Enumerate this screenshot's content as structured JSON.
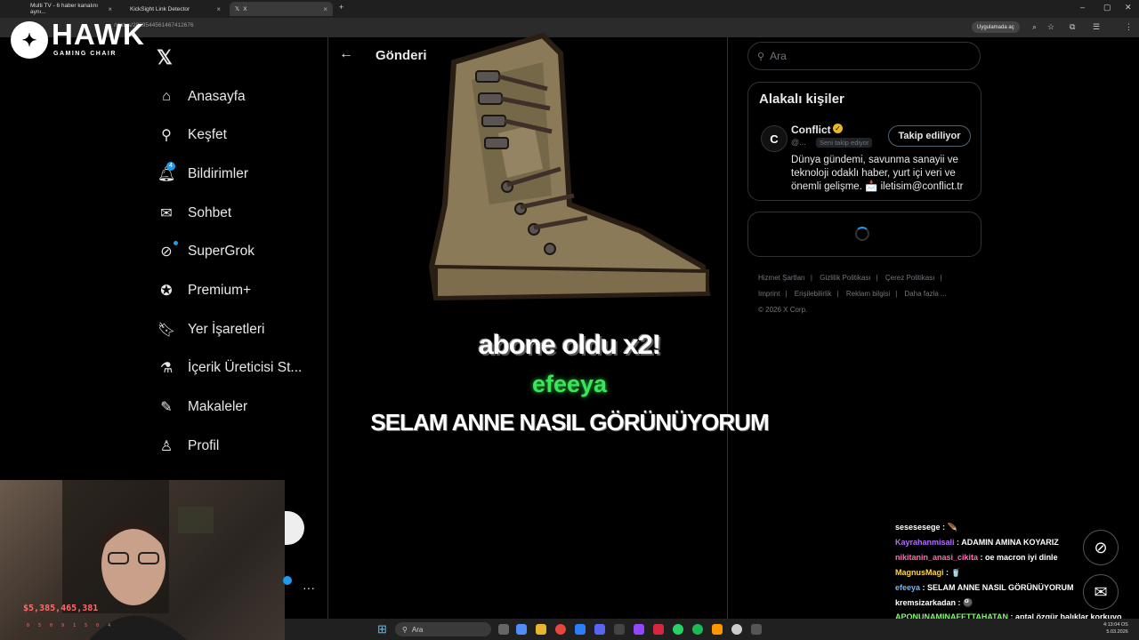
{
  "browser": {
    "tabs": [
      {
        "title": "Multi TV - 6 haber kanalını aynı..."
      },
      {
        "title": "KickSight Link Detector"
      },
      {
        "title": "X"
      }
    ],
    "url": "/status/2029544561467412676",
    "open_in_app": "Uygulamada aç"
  },
  "overlay": {
    "brand": "HAWK",
    "brand_sub": "GAMING CHAIR"
  },
  "nav": {
    "items": [
      {
        "label": "Anasayfa",
        "icon": "home-icon"
      },
      {
        "label": "Keşfet",
        "icon": "search-icon"
      },
      {
        "label": "Bildirimler",
        "icon": "bell-icon",
        "badge": "4"
      },
      {
        "label": "Sohbet",
        "icon": "mail-icon"
      },
      {
        "label": "SuperGrok",
        "icon": "grok-icon"
      },
      {
        "label": "Premium+",
        "icon": "verified-icon"
      },
      {
        "label": "Yer İşaretleri",
        "icon": "bookmark-icon"
      },
      {
        "label": "İçerik Üreticisi St...",
        "icon": "flask-icon"
      },
      {
        "label": "Makaleler",
        "icon": "article-icon"
      },
      {
        "label": "Profil",
        "icon": "person-icon"
      }
    ]
  },
  "post": {
    "title": "Gönderi"
  },
  "stream_alert": {
    "line1": "abone oldu x2!",
    "user": "efeeya",
    "message": "SELAM ANNE NASIL GÖRÜNÜYORUM"
  },
  "sidebar": {
    "search_placeholder": "Ara",
    "related_title": "Alakalı kişiler",
    "person": {
      "name": "Conflict",
      "handle": "@...",
      "follows_you": "Seni takip ediyor",
      "follow_button": "Takip ediliyor",
      "bio": "Dünya gündemi, savunma sanayii ve teknoloji odaklı haber, yurt içi veri ve önemli gelişme. 📩 iletisim@conflict.tr"
    },
    "footer": [
      "Hizmet Şartları",
      "Gizlilik Politikası",
      "Çerez Politikası",
      "Imprint",
      "Erişilebilirlik",
      "Reklam bilgisi",
      "Daha fazla ...",
      "© 2026 X Corp."
    ]
  },
  "webcam": {
    "ticker": "$5,385,465,381",
    "stats": [
      "05",
      "09",
      "15",
      "04"
    ]
  },
  "chat": [
    {
      "user": "sesesesege",
      "msg": "🪶",
      "color": "#ffffff"
    },
    {
      "user": "Kayrahanmisali",
      "msg": "ADAMIN AMINA KOYARIZ",
      "color": "#b36bff"
    },
    {
      "user": "nikitanin_anasi_cikita",
      "msg": "oe macron iyi dinle",
      "color": "#ff6bb5"
    },
    {
      "user": "MagnusMagi",
      "msg": "🥤",
      "color": "#ffd54a"
    },
    {
      "user": "efeeya",
      "msg": "SELAM ANNE NASIL GÖRÜNÜYORUM",
      "color": "#6bb8ff"
    },
    {
      "user": "kremsizarkadan",
      "msg": "🎱",
      "color": "#ffffff"
    },
    {
      "user": "APONUNAMINAFETTAHATAN",
      "msg": "aptal özgür balıklar korkuyo diye açıklama yaparsa böyle olur",
      "color": "#7dff6b"
    }
  ],
  "taskbar": {
    "search": "Ara",
    "time": "4:13:04 OS",
    "date": "5.03.2026"
  },
  "colors": {
    "accent": "#1d9bf0",
    "alert_green": "#39e65a"
  }
}
